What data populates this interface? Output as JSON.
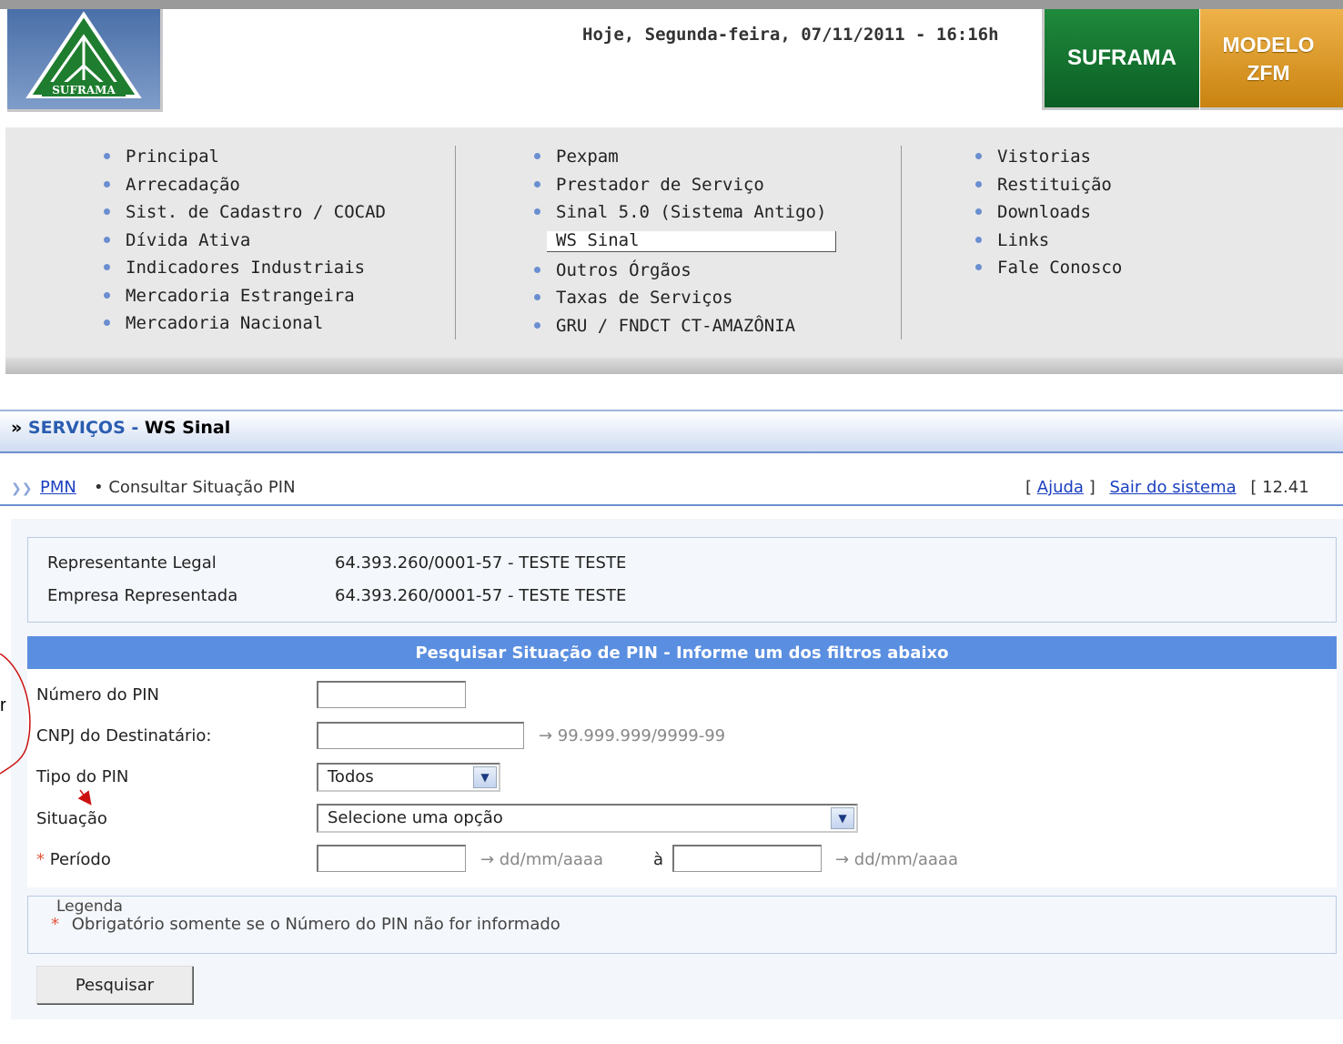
{
  "header": {
    "logo_text": "SUFRAMA",
    "date": "Hoje, Segunda-feira, 07/11/2011 - 16:16h",
    "btn_suframa": "SUFRAMA",
    "btn_modelo_line1": "MODELO",
    "btn_modelo_line2": "ZFM"
  },
  "menu": {
    "col1": [
      "Principal",
      "Arrecadação",
      "Sist. de Cadastro / COCAD",
      "Dívida Ativa",
      "Indicadores Industriais",
      "Mercadoria Estrangeira",
      "Mercadoria Nacional"
    ],
    "col2_a": [
      "Pexpam",
      "Prestador de Serviço",
      "Sinal 5.0 (Sistema Antigo)"
    ],
    "col2_selected": "WS Sinal",
    "col2_b": [
      "Outros Órgãos",
      "Taxas de Serviços",
      "GRU / FNDCT CT-AMAZÔNIA"
    ],
    "col3": [
      "Vistorias",
      "Restituição",
      "Downloads",
      "Links",
      "Fale Conosco"
    ]
  },
  "section": {
    "prefix": "»",
    "servicos": "SERVIÇOS",
    "sep": "-",
    "current": "WS Sinal"
  },
  "crumb": {
    "pmn": "PMN",
    "rest": "• Consultar Situação PIN",
    "open": "[",
    "ajuda": "Ajuda",
    "close": "]",
    "sair": "Sair do sistema",
    "extra": "[ 12.41"
  },
  "rep": {
    "legal_label": "Representante Legal",
    "legal_value": "64.393.260/0001-57 - TESTE TESTE",
    "empresa_label": "Empresa Representada",
    "empresa_value": "64.393.260/0001-57 - TESTE TESTE"
  },
  "form": {
    "title": "Pesquisar Situação de PIN - Informe um dos filtros abaixo",
    "pin_label": "Número do PIN",
    "cnpj_label": "CNPJ do Destinatário:",
    "cnpj_hint": "→ 99.999.999/9999-99",
    "tipo_label": "Tipo do PIN",
    "tipo_value": "Todos",
    "situacao_label": "Situação",
    "situacao_value": "Selecione uma opção",
    "periodo_star": "*",
    "periodo_label": "Período",
    "periodo_hint1": "→ dd/mm/aaaa",
    "periodo_a": "à",
    "periodo_hint2": "→ dd/mm/aaaa"
  },
  "legend": {
    "title": "Legenda",
    "star": "*",
    "text": "Obrigatório somente se o Número do PIN não for informado"
  },
  "buttons": {
    "pesquisar": "Pesquisar"
  },
  "annotation": {
    "letter": "r"
  },
  "colors": {
    "accent_blue": "#5a8ee0",
    "suframa_green": "#0b5e24",
    "modelo_orange": "#c9830f",
    "annotation_red": "#cc1111"
  }
}
